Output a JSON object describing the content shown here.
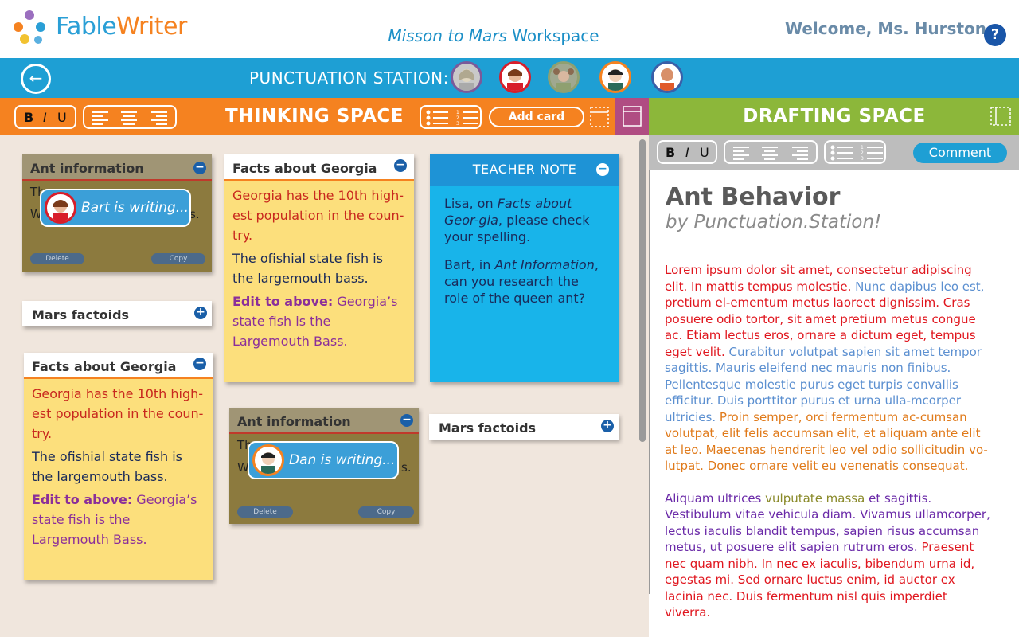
{
  "app": {
    "brand": "FableWriter",
    "brand_part1": "Fable",
    "brand_part2": "Writer",
    "workspace_italic": "Misson to Mars",
    "workspace_suffix": "Workspace",
    "welcome": "Welcome, Ms. Hurston",
    "help_icon": "?"
  },
  "station": {
    "label": "PUNCTUATION STATION:",
    "members": [
      {
        "icon": "avatar-gray-girl",
        "ring": "#7a5a9a"
      },
      {
        "icon": "avatar-red-boy",
        "ring": "#d81e2a"
      },
      {
        "icon": "avatar-pigtails-girl",
        "ring": "#8fa070"
      },
      {
        "icon": "avatar-orange-boy",
        "ring": "#f58220"
      },
      {
        "icon": "avatar-bald-boy",
        "ring": "#3a5fa8"
      }
    ]
  },
  "thinking": {
    "title": "THINKING SPACE",
    "add_card": "Add card",
    "bold": "B",
    "italic": "I",
    "underline": "U"
  },
  "drafting": {
    "title": "DRAFTING SPACE",
    "comment": "Comment",
    "bold": "B",
    "italic": "I",
    "underline": "U",
    "doc_title": "Ant Behavior",
    "doc_byline": "by Punctuation.Station!",
    "para1": [
      {
        "t": "Lorem ipsum dolor sit amet, consectetur adipiscing elit. In mattis tempus molestie. ",
        "c": "red"
      },
      {
        "t": "Nunc dapibus leo est, ",
        "c": "blue"
      },
      {
        "t": "pretium el-ementum metus laoreet dignissim. Cras posuere odio tortor, sit amet pretium metus congue ac. Etiam lectus eros, ornare a dictum eget, tempus eget velit. ",
        "c": "red"
      },
      {
        "t": "Curabitur volutpat sapien sit amet tempor sagittis. Mauris eleifend nec mauris non finibus. Pellentesque molestie purus eget turpis convallis efficitur. Duis porttitor purus et urna ulla-mcorper ultricies. ",
        "c": "blue"
      },
      {
        "t": "Proin semper, orci fermentum ac-cumsan volutpat, elit felis accumsan elit, et aliquam ante elit at leo. Maecenas hendrerit leo vel odio sollicitudin vo-lutpat. Donec ornare velit eu venenatis consequat.",
        "c": "orange"
      }
    ],
    "para2": [
      {
        "t": "Aliquam ultrices ",
        "c": "purple"
      },
      {
        "t": "vulputate massa ",
        "c": "olive"
      },
      {
        "t": "et sagittis. Vestibulum vitae vehicula diam. Vivamus ullamcorper, lectus iaculis blandit tempus, sapien risus accumsan metus, ut posuere elit sapien rutrum eros. ",
        "c": "purple"
      },
      {
        "t": "Praesent nec quam nibh. In nec ex iaculis, bibendum urna id, egestas mi. Sed ornare luctus enim, id auctor ex lacinia nec. Duis fermentum nisl quis imperdiet viverra.",
        "c": "red"
      }
    ]
  },
  "cards": {
    "ant1": {
      "title": "Ant information",
      "body_fragment_1": "Th",
      "body_fragment_2": "W",
      "body_fragment_3": "s.",
      "writer": "Bart is writing...",
      "delete": "Delete",
      "copy": "Copy"
    },
    "mars1": {
      "title": "Mars factoids"
    },
    "georgia1": {
      "title": "Facts about Georgia",
      "red_text": "Georgia has the 10th high-est population in the coun-try.",
      "navy_text": "The ofishial state fish is the largemouth bass.",
      "edit_label": "Edit to above:",
      "edit_text": " Georgia’s state fish is the Largemouth Bass."
    },
    "georgia2": {
      "title": "Facts about Georgia",
      "red_text": "Georgia has the 10th high-est population in the coun-try.",
      "navy_text": "The ofishial state fish is the largemouth bass.",
      "edit_label": "Edit to above:",
      "edit_text": " Georgia’s state fish is the Largemouth Bass."
    },
    "ant2": {
      "title": "Ant information",
      "body_fragment_1": "Th",
      "body_fragment_2": "W",
      "body_fragment_3": "s.",
      "writer": "Dan is writing...",
      "delete": "Delete",
      "copy": "Copy"
    },
    "mars2": {
      "title": "Mars factoids"
    },
    "teacher_note": {
      "title": "TEACHER NOTE",
      "p1_a": "Lisa, on ",
      "p1_italic": "Facts about Geor-gia",
      "p1_b": ", please check your spelling.",
      "p2_a": "Bart, in ",
      "p2_italic": "Ant Information",
      "p2_b": ", can you research the role of the queen ant?"
    }
  },
  "colors": {
    "orange": "#f58220",
    "green": "#8cb73a",
    "blue": "#1e9fd4",
    "note": "#18b4ea",
    "sticky": "#fcdf7c"
  }
}
